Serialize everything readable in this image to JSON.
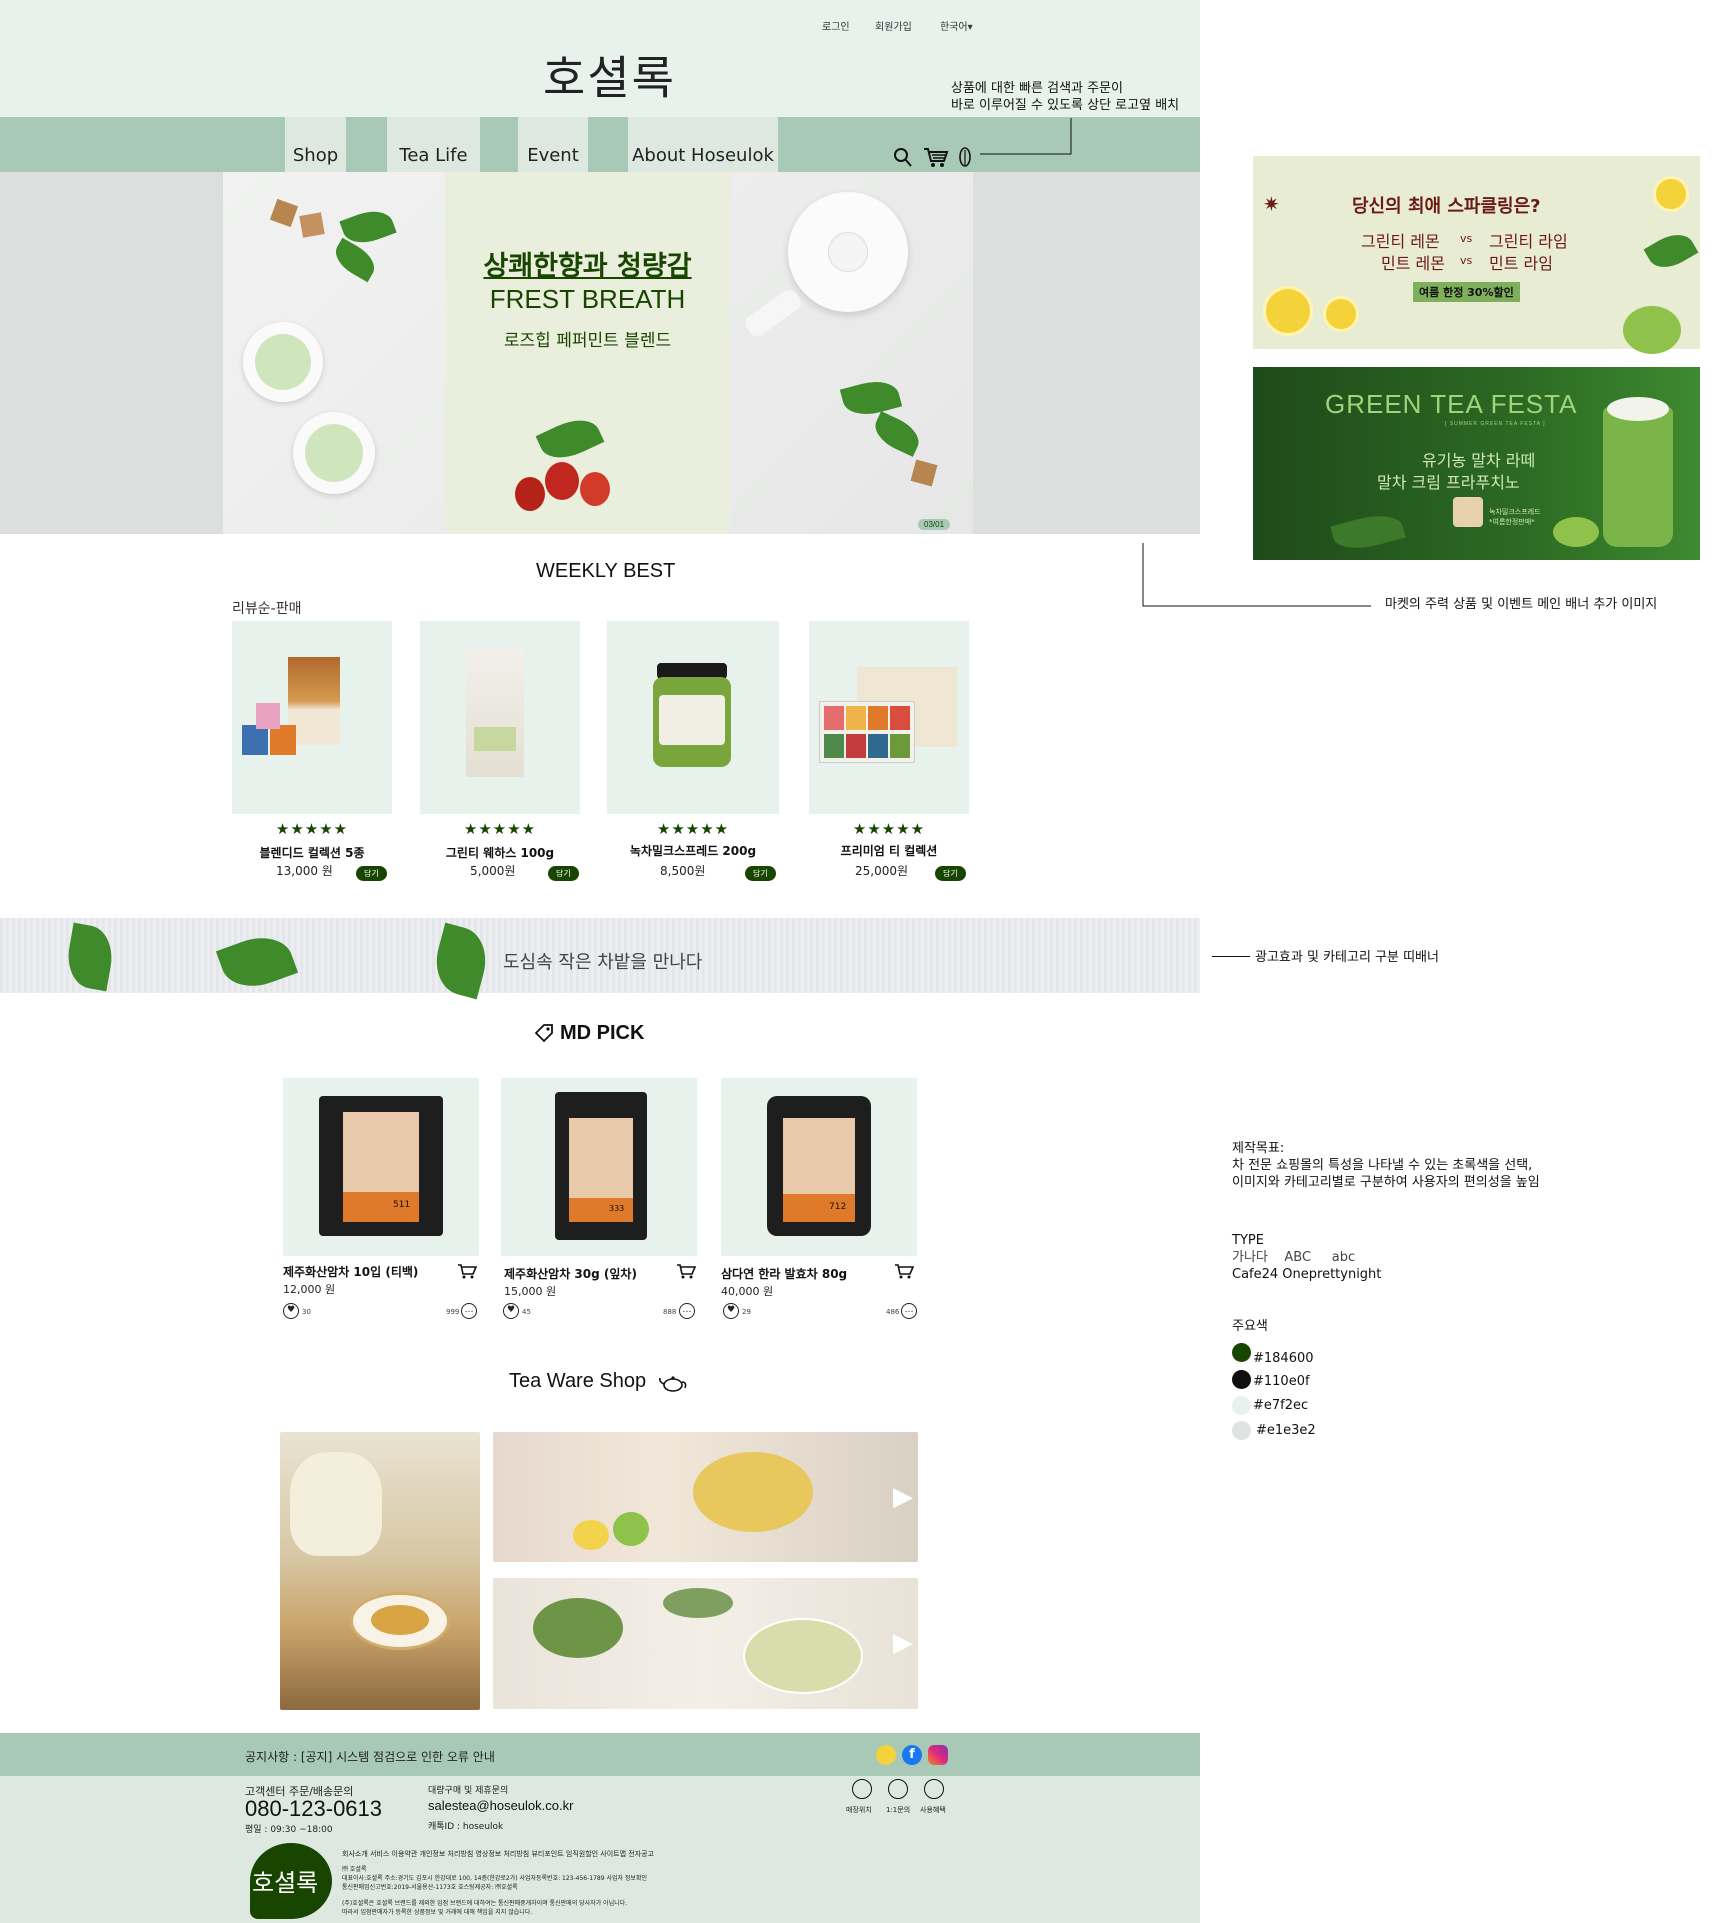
{
  "header": {
    "login": "로그인",
    "signup": "회원가입",
    "language": "한국어▾",
    "logo": "호셜록"
  },
  "nav": {
    "tabs": [
      "Shop",
      "Tea Life",
      "Event",
      "About Hoseulok"
    ],
    "icons": [
      "search-icon",
      "cart-icon",
      "leaf-icon"
    ]
  },
  "hero": {
    "line1": "상쾌한향과 청량감",
    "line2": "FREST BREATH",
    "line3": "로즈힙 페퍼민트 블렌드",
    "pager": "03/01"
  },
  "weekly_best": {
    "title": "WEEKLY BEST",
    "sort_label": "리뷰순-판매",
    "items": [
      {
        "stars": "★★★★★",
        "name": "블렌디드 컬렉션 5종",
        "price": "13,000 원",
        "button": "담기"
      },
      {
        "stars": "★★★★★",
        "name": "그린티 웨하스 100g",
        "price": "5,000원",
        "button": "담기"
      },
      {
        "stars": "★★★★★",
        "name": "녹차밀크스프레드 200g",
        "price": "8,500원",
        "button": "담기"
      },
      {
        "stars": "★★★★★",
        "name": "프리미엄 티 컬렉션",
        "price": "25,000원",
        "button": "담기"
      }
    ]
  },
  "strip": {
    "text": "도심속 작은 차밭을 만나다"
  },
  "md_pick": {
    "title": "MD PICK",
    "items": [
      {
        "name": "제주화산암차 10입 (티백)",
        "price": "12,000 원",
        "likes": "30",
        "comments": "999",
        "can_no": "511"
      },
      {
        "name": "제주화산암차 30g (잎차)",
        "price": "15,000 원",
        "likes": "45",
        "comments": "888",
        "can_no": "333"
      },
      {
        "name": "삼다연 한라 발효차 80g",
        "price": "40,000 원",
        "likes": "29",
        "comments": "486",
        "can_no": "712"
      }
    ]
  },
  "tea_ware": {
    "title": "Tea Ware Shop"
  },
  "footer": {
    "notice": "공지사항 : [공지] 시스템 점검으로 인한 오류 안내",
    "cs_label": "고객센터 주문/배송문의",
    "phone": "080-123-0613",
    "hours": "평일 : 09:30 ~18:00",
    "bulk_label": "대량구매 및 제휴문의",
    "email": "salestea@hoseulok.co.kr",
    "kakao": "캐톡ID : hoseulok",
    "quick_links": [
      "매장위치",
      "1:1문의",
      "사용혜택"
    ],
    "logo": "호셜록",
    "legal1": "회사소개 서비스 이용약관 개인정보 처리방침 영상정보 처리방침 뷰티포인트 임직원할인 사이트맵 전자공고",
    "legal2": "㈜ 호셜록",
    "legal3": "대표이사:호셜록 주소:경기도 김포시 한강대로 100, 14층(한강로2가) 사업자등록번호: 123-456-1789 사업자 정보확인",
    "legal4": "통신판매업신고번호:2019-서울용산-1173호 호스팅제공자: ㈜호셜록",
    "legal5": "(주)호셜록은 호셜록 브랜드를 제외한 입점 브랜드에 대하여는 통신판매중개자이며 통신판매의 당사자가 아닙니다.",
    "legal6": "따라서 입점판매자가 등록한 상품정보 및 거래에 대해 책임을 지지 않습니다."
  },
  "notes": {
    "search_note1": "상품에 대한 빠른 검색과 주문이",
    "search_note2": "바로 이루어질 수 있도록 상단 로고옆 배치",
    "banner_note": "마켓의 주력 상품 및 이벤트 메인 배너 추가 이미지",
    "strip_note": "광고효과 및 카테고리 구분 띠배너",
    "goal_title": "제작목표:",
    "goal1": "차 전문 쇼핑몰의 특성을 나타낼 수 있는 초록색을 선택,",
    "goal2": "이미지와 카테고리별로 구분하여 사용자의 편의성을 높임",
    "type_title": "TYPE",
    "type_samples": "가나다    ABC     abc",
    "type_font": "Cafe24 Oneprettynight",
    "color_title": "주요색",
    "colors": [
      "#184600",
      "#110e0f",
      "#e7f2ec",
      "#e1e3e2"
    ]
  },
  "promo1": {
    "title": "당신의 최애 스파클링은?",
    "line1_a": "그린티 레몬",
    "vs": "vs",
    "line1_b": "그린티 라임",
    "line2_a": "민트 레몬",
    "line2_b": "민트 라임",
    "badge": "여름 한정 30%할인"
  },
  "promo2": {
    "title": "GREEN TEA FESTA",
    "sub": "[ SUMMER GREEN TEA FESTA ]",
    "line1": "유기농 말차 라떼",
    "line2": "말차 크림 프라푸치노",
    "badge1": "녹차밀크스프레드",
    "badge2": "*여름한정판매*"
  }
}
